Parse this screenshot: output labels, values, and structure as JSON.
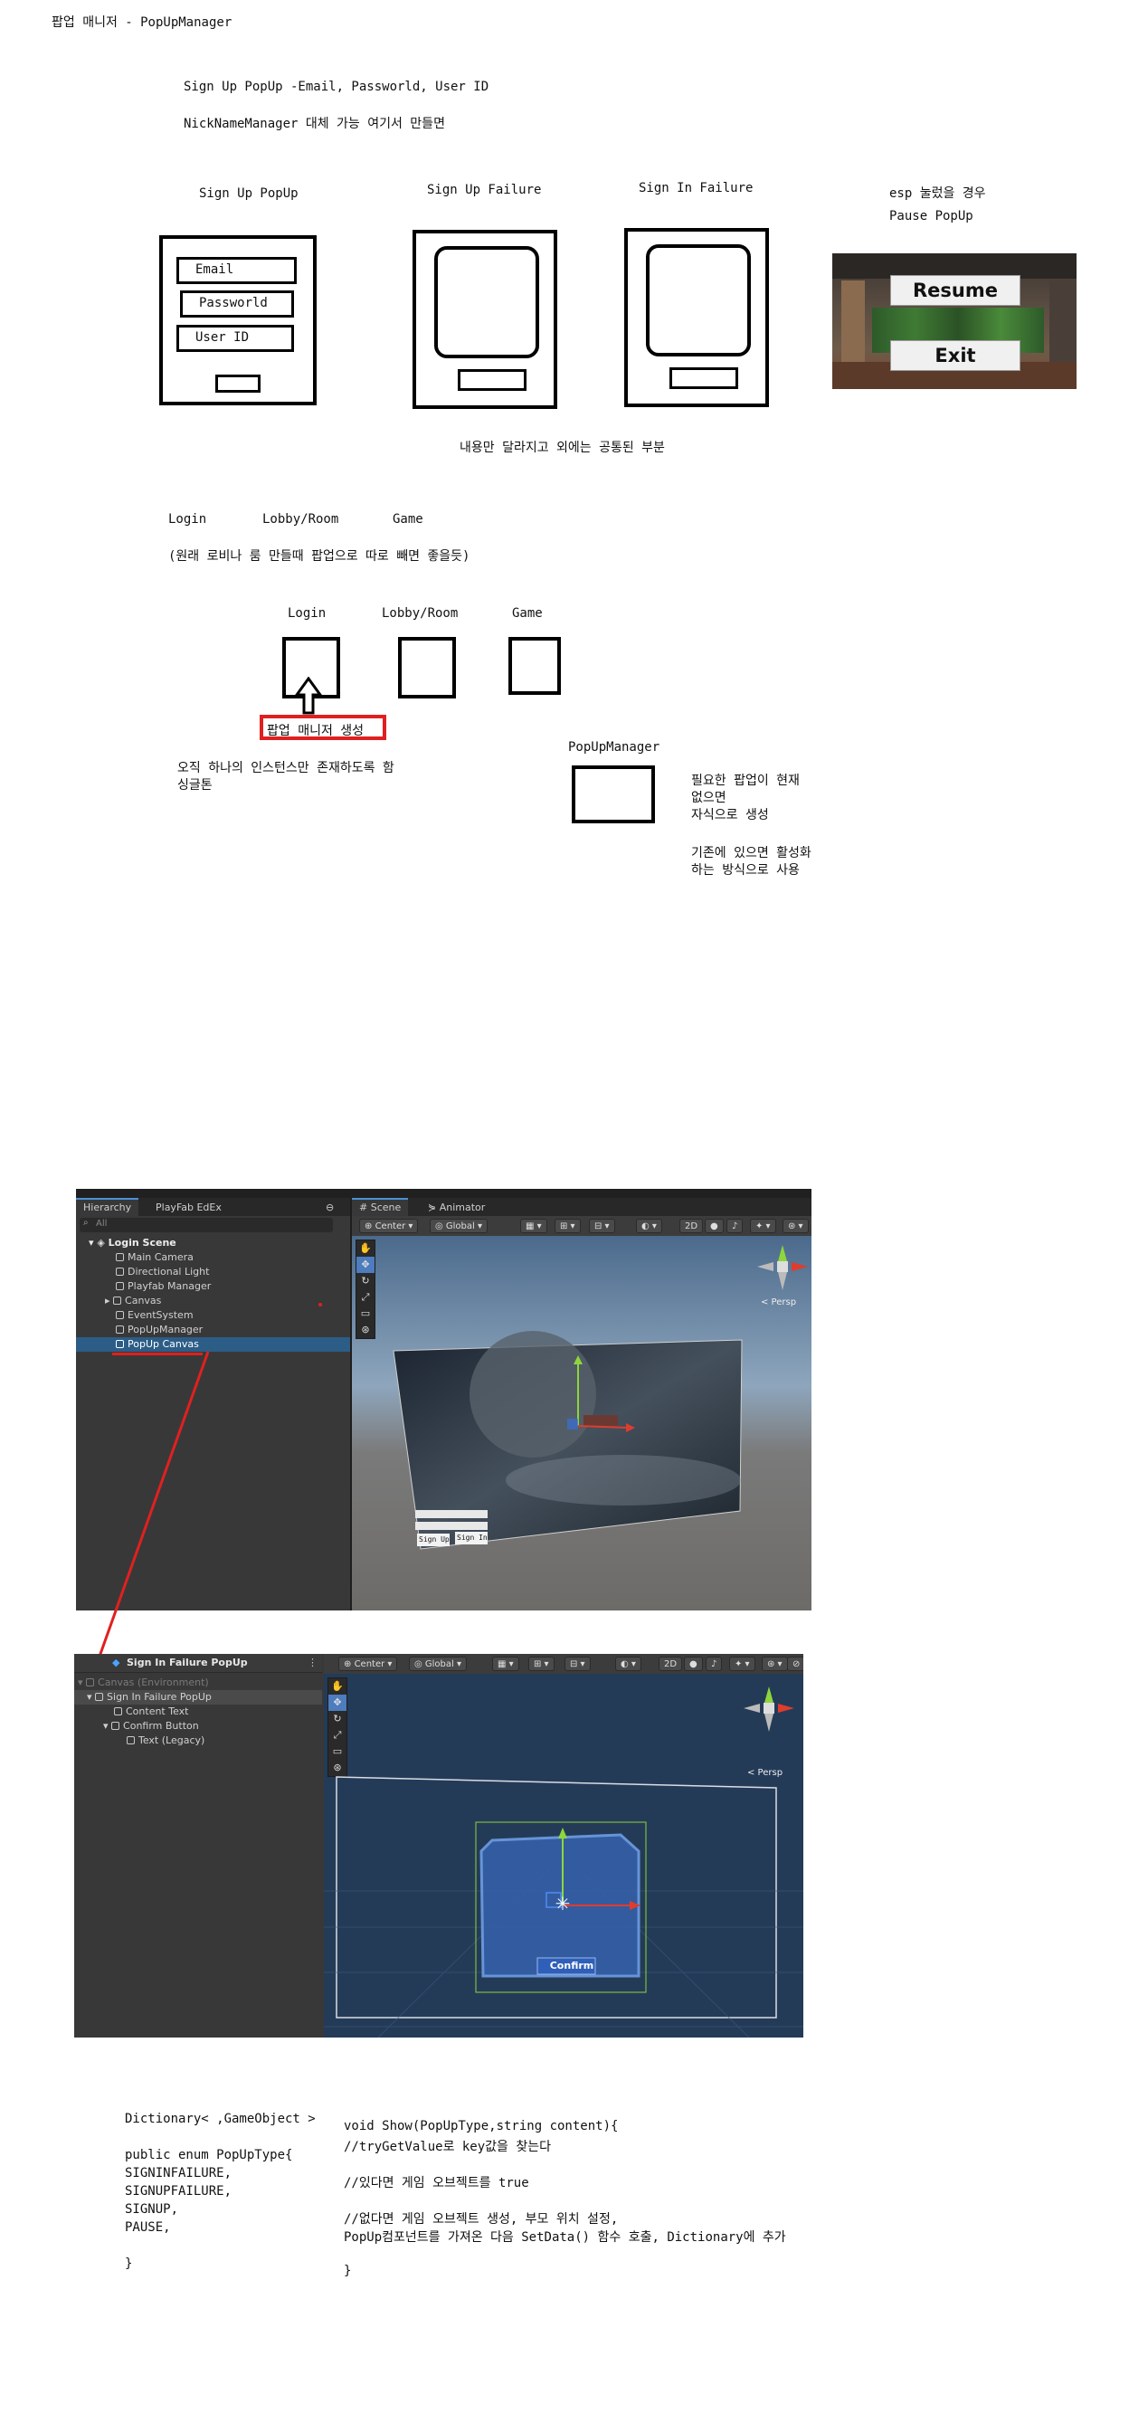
{
  "page": {
    "title": "팝업 매니저 - PopUpManager"
  },
  "notes": {
    "line1": "Sign Up PopUp -Email, Passworld, User ID",
    "line2": "NickNameManager 대체 가능 여기서 만들면"
  },
  "popups": {
    "signup_title": "Sign Up PopUp",
    "signup_fields": [
      "Email",
      "Passworld",
      "User ID"
    ],
    "signup_failure_title": "Sign Up Failure",
    "signin_failure_title": "Sign In Failure",
    "esc_note_1": "esp 눌렀을 경우",
    "esc_note_2": "Pause PopUp",
    "pause_buttons": [
      "Resume",
      "Exit"
    ],
    "common_note": "내용만 달라지고 외에는  공통된 부분"
  },
  "scenes_top": {
    "labels": [
      "Login",
      "Lobby/Room",
      "Game"
    ],
    "note": "(원래 로비나 룸 만들때 팝업으로 따로 빼면 좋을듯)"
  },
  "scene_diagram": {
    "labels": [
      "Login",
      "Lobby/Room",
      "Game"
    ],
    "create_label": "팝업 매니저 생성",
    "singleton_line1": "오직 하나의 인스턴스만 존재하도록 함",
    "singleton_line2": "싱글톤",
    "manager_label": "PopUpManager",
    "manager_note": [
      "필요한 팝업이 현재",
      "없으면",
      "자식으로 생성",
      "",
      "기존에 있으면 활성화",
      "하는 방식으로 사용"
    ]
  },
  "unity1": {
    "tabs": [
      "Hierarchy",
      "PlayFab EdEx"
    ],
    "scene_tabs": [
      "# Scene",
      "⋟ Animator"
    ],
    "search_placeholder": "All",
    "scene_name": "Login Scene",
    "items": [
      "Main Camera",
      "Directional Light",
      "Playfab Manager",
      "Canvas",
      "EventSystem",
      "PopUpManager",
      "PopUp Canvas"
    ],
    "toolbar": [
      "Center",
      "Global",
      "2D"
    ],
    "persp": "< Persp",
    "mini_buttons": [
      "Sign Up",
      "Sign In"
    ]
  },
  "unity2": {
    "header": "Sign In Failure PopUp",
    "items": [
      "Canvas (Environment)",
      "Sign In Failure PopUp",
      "Content Text",
      "Confirm Button",
      "Text (Legacy)"
    ],
    "toolbar": [
      "Center",
      "Global",
      "2D"
    ],
    "persp": "< Persp",
    "confirm_label": "Confirm"
  },
  "code": {
    "left": [
      "Dictionary< ,GameObject >",
      "",
      "public enum PopUpType{",
      "SIGNINFAILURE,",
      "SIGNUPFAILURE,",
      "SIGNUP,",
      "PAUSE,",
      "",
      "}"
    ],
    "right": [
      "void Show(PopUpType,string content){",
      "//tryGetValue로 key값을 찾는다",
      "",
      "//있다면 게임 오브젝트를 true",
      "",
      "//없다면 게임 오브젝트 생성, 부모 위치 설정,",
      "PopUp컴포넌트를 가져온 다음 SetData() 함수 호출, Dictionary에 추가",
      "",
      "}"
    ]
  },
  "colors": {
    "highlight_red": "#e02020",
    "unity_selection": "#2c5d87",
    "unity_panel": "#383838"
  }
}
